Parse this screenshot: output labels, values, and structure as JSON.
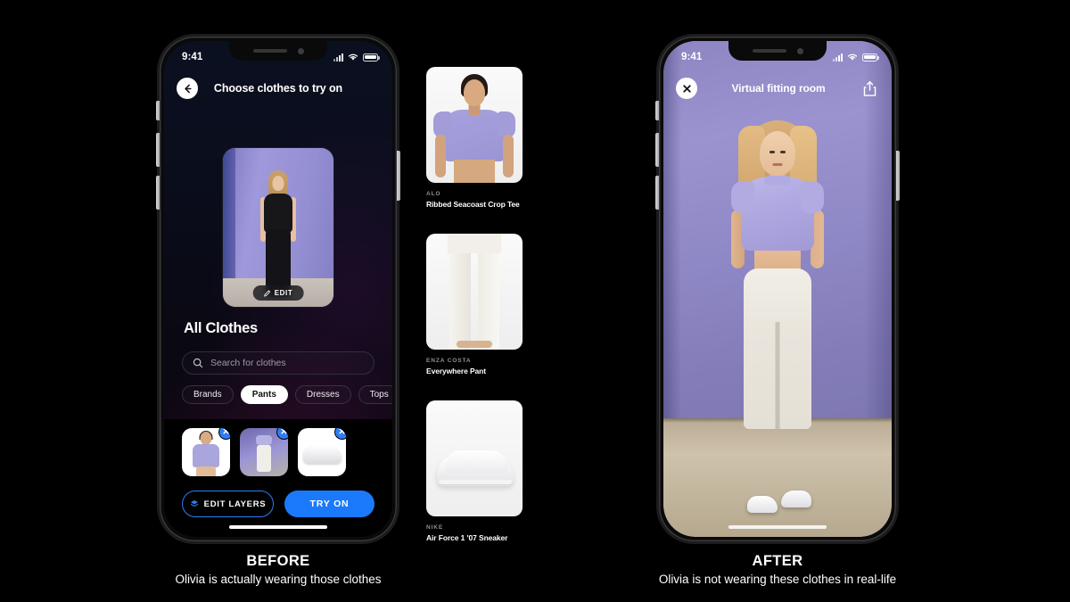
{
  "left_phone": {
    "status": {
      "time": "9:41",
      "signal_icon": "cellular-bars-icon",
      "wifi_icon": "wifi-icon",
      "battery_icon": "battery-icon"
    },
    "nav": {
      "back_icon": "back-arrow-icon",
      "title": "Choose clothes to try on"
    },
    "avatar": {
      "edit_label": "EDIT",
      "edit_icon": "pencil-icon"
    },
    "section_title": "All Clothes",
    "search": {
      "placeholder": "Search for clothes",
      "icon": "search-icon"
    },
    "chips": [
      {
        "label": "Brands",
        "active": false
      },
      {
        "label": "Pants",
        "active": true
      },
      {
        "label": "Dresses",
        "active": false
      },
      {
        "label": "Tops",
        "active": false
      }
    ],
    "tray": {
      "thumbs": [
        {
          "name": "selected-crop-tee-thumb",
          "remove_icon": "close-icon",
          "remove_label": "✕"
        },
        {
          "name": "selected-pant-thumb",
          "remove_icon": "close-icon",
          "remove_label": "✕"
        },
        {
          "name": "selected-sneaker-thumb",
          "remove_icon": "close-icon",
          "remove_label": "✕"
        }
      ],
      "edit_layers_label": "EDIT LAYERS",
      "edit_layers_icon": "layers-icon",
      "try_on_label": "TRY ON"
    }
  },
  "products": [
    {
      "brand": "ALO",
      "name": "Ribbed Seacoast Crop Tee"
    },
    {
      "brand": "ENZA COSTA",
      "name": "Everywhere Pant"
    },
    {
      "brand": "NIKE",
      "name": "Air Force 1 '07 Sneaker"
    }
  ],
  "right_phone": {
    "status": {
      "time": "9:41",
      "signal_icon": "cellular-bars-icon",
      "wifi_icon": "wifi-icon",
      "battery_icon": "battery-icon"
    },
    "nav": {
      "close_icon": "close-icon",
      "title": "Virtual fitting room",
      "share_icon": "share-icon"
    }
  },
  "captions": {
    "before": {
      "heading": "BEFORE",
      "subtitle": "Olivia is actually wearing those clothes"
    },
    "after": {
      "heading": "AFTER",
      "subtitle": "Olivia is not wearing these clothes in real-life"
    }
  },
  "colors": {
    "accent_blue": "#1b7afb",
    "background": "#000000",
    "chip_active": "#ffffff",
    "lilac": "#a9a2dc"
  }
}
